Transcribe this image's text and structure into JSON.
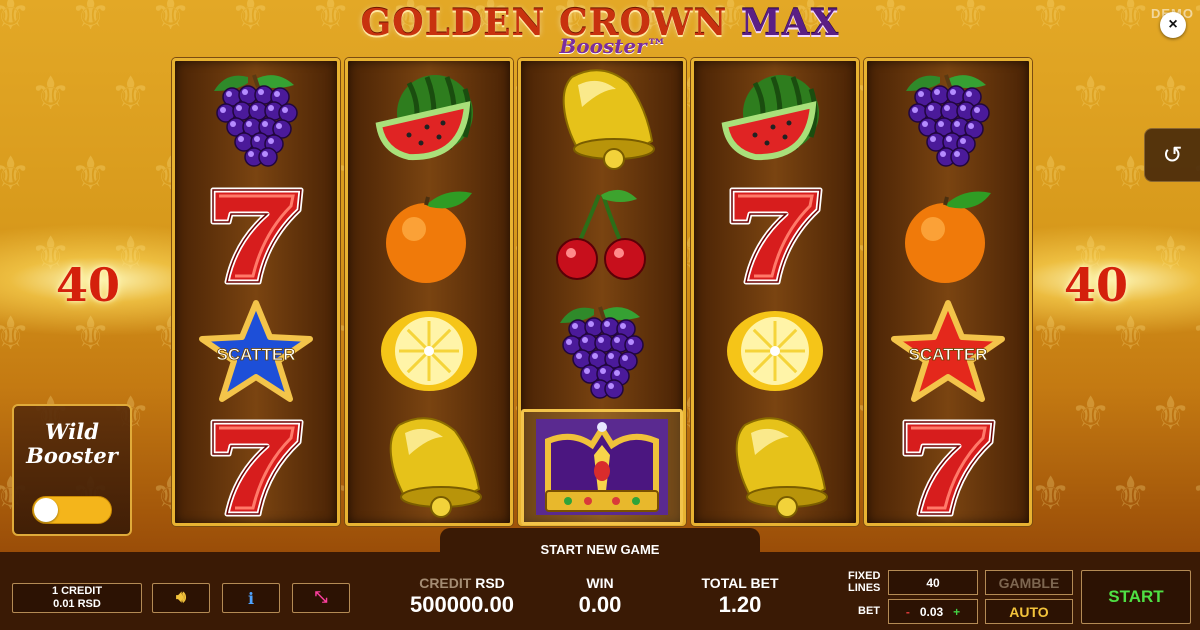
{
  "title": {
    "main": "GOLDEN CROWN",
    "max": "MAX",
    "subtitle": "Booster™"
  },
  "demo_label": "DEMO",
  "icons": {
    "close": "close-icon",
    "history": "history-icon",
    "sound": "speaker-icon",
    "info": "info-icon",
    "fullscreen": "fullscreen-icon"
  },
  "lines_display": {
    "left": "40",
    "right": "40"
  },
  "reels": [
    [
      "grapes",
      "seven",
      "scatter-blue",
      "seven"
    ],
    [
      "watermelon",
      "orange",
      "lemon",
      "bell"
    ],
    [
      "bell",
      "cherries",
      "grapes",
      "crown"
    ],
    [
      "watermelon",
      "seven",
      "lemon",
      "bell"
    ],
    [
      "grapes",
      "orange",
      "scatter-red",
      "seven"
    ]
  ],
  "scatter_label": "SCATTER",
  "wild_booster": {
    "line1": "Wild",
    "line2": "Booster",
    "enabled": false
  },
  "bottom_bar": {
    "start_new_game": "START NEW GAME",
    "credit_value_line1": "1 CREDIT",
    "credit_value_line2": "0.01 RSD",
    "credit_label": "CREDIT",
    "credit_currency": "RSD",
    "credit": "500000.00",
    "win_label": "WIN",
    "win": "0.00",
    "total_bet_label": "TOTAL BET",
    "total_bet": "1.20",
    "fixed_lines_label_1": "FIXED",
    "fixed_lines_label_2": "LINES",
    "fixed_lines": "40",
    "bet_label": "BET",
    "bet_minus": "-",
    "bet": "0.03",
    "bet_plus": "+",
    "gamble": "GAMBLE",
    "auto": "AUTO",
    "start": "START"
  },
  "colors": {
    "accent_gold": "#e8b332",
    "start_green": "#4fe044",
    "auto_yellow": "#f3c33b",
    "bar_bg": "#3a1a05"
  }
}
